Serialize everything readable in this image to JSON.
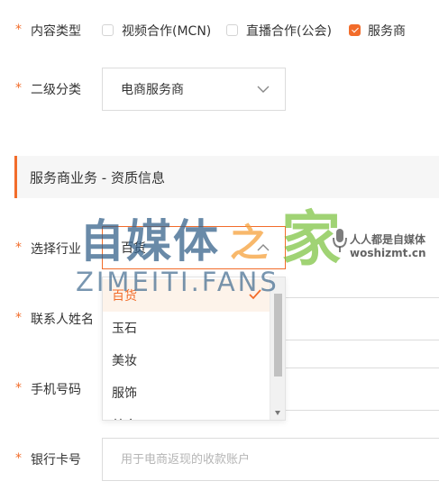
{
  "content_type": {
    "label": "内容类型",
    "options": [
      {
        "label": "视频合作(MCN)",
        "checked": false
      },
      {
        "label": "直播合作(公会)",
        "checked": false
      },
      {
        "label": "服务商",
        "checked": true
      }
    ]
  },
  "secondary_category": {
    "label": "二级分类",
    "value": "电商服务商"
  },
  "section_title": "服务商业务 - 资质信息",
  "industry": {
    "label": "选择行业",
    "value": "百货",
    "options": [
      "百货",
      "玉石",
      "美妆",
      "服饰",
      "美食"
    ],
    "selected_index": 0
  },
  "contact_name": {
    "label": "联系人姓名",
    "value": "",
    "placeholder": ""
  },
  "phone": {
    "label": "手机号码",
    "value": "",
    "placeholder": ""
  },
  "bank_card": {
    "label": "银行卡号",
    "value": "",
    "placeholder": "用于电商返现的收款账户"
  },
  "required_mark": "*",
  "watermark": {
    "main": "自媒体",
    "connector": "之",
    "home": "家",
    "domain": "ZIMEITI.FANS",
    "tagline": "人人都是自媒体",
    "site": "woshizmt.cn"
  },
  "colors": {
    "accent": "#f26c2a",
    "watermark_blue": "#2f5d86",
    "watermark_green": "#7cc23f",
    "watermark_orange": "#f5a03a"
  }
}
